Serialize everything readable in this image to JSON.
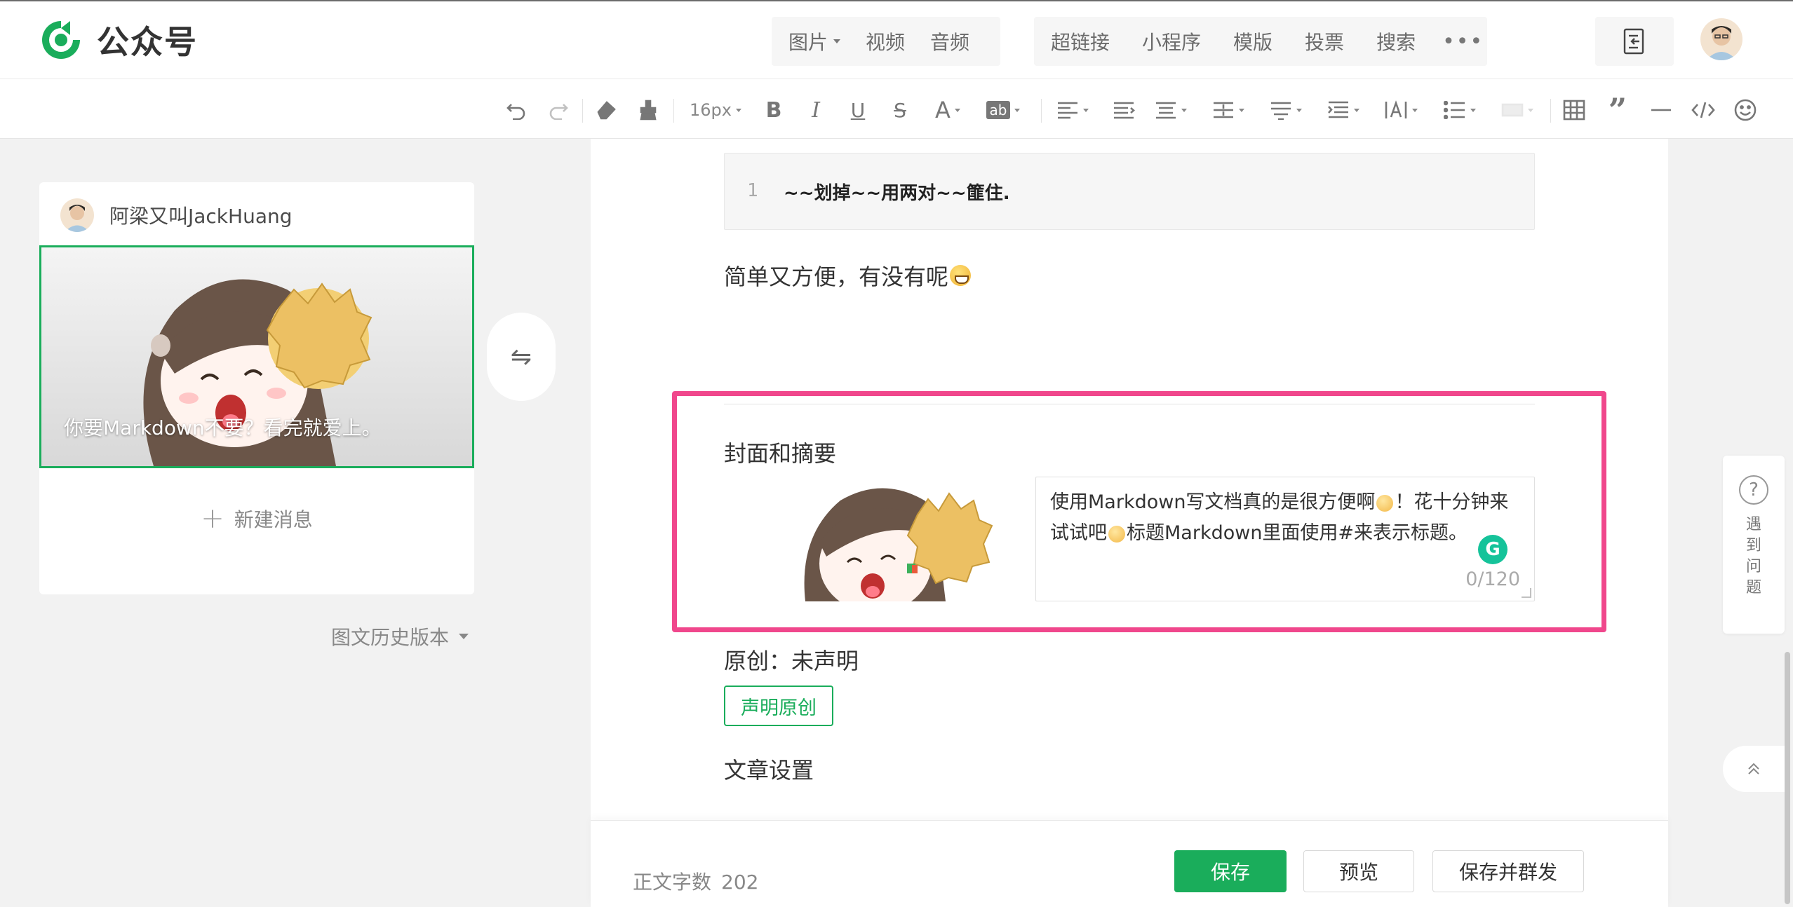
{
  "app": {
    "name": "公众号"
  },
  "nav": {
    "media": [
      {
        "label": "图片",
        "has_dropdown": true
      },
      {
        "label": "视频",
        "has_dropdown": false
      },
      {
        "label": "音频",
        "has_dropdown": false
      }
    ],
    "links": [
      "超链接",
      "小程序",
      "模版",
      "投票",
      "搜索"
    ],
    "more_icon": "ellipsis-icon",
    "doc_icon": "document-toggle-icon"
  },
  "toolbar": {
    "font_size": "16px",
    "tools": [
      "undo-icon",
      "redo-icon",
      "eraser-icon",
      "format-painter-icon",
      "bold-icon",
      "italic-icon",
      "underline-icon",
      "strikethrough-icon",
      "font-color-icon",
      "background-color-icon",
      "align-icon",
      "indent-icon",
      "justify-icon",
      "line-height-icon",
      "paragraph-spacing-icon",
      "list-indent-icon",
      "letter-spacing-icon",
      "bullet-list-icon",
      "border-icon",
      "table-icon",
      "quote-icon",
      "horizontal-rule-icon",
      "code-icon",
      "emoji-icon"
    ]
  },
  "left_panel": {
    "author": "阿梁又叫JackHuang",
    "cover_title": "你要Markdown不要？看完就爱上。",
    "new_message": "新建消息",
    "history": "图文历史版本"
  },
  "editor": {
    "code_line_number": "1",
    "code_text": "~~划掉~~用两对~~篚住.",
    "paragraph": "简单又方便，有没有呢",
    "cover_section_title": "封面和摘要",
    "summary_part1": "使用Markdown写文档真的是很方便啊",
    "summary_part2": "！花十分钟来试试吧",
    "summary_part3": "标题Markdown里面使用#来表示标题。",
    "summary_counter": "0/120",
    "original_label": "原创：未声明",
    "declare_button": "声明原创",
    "article_settings": "文章设置"
  },
  "bottom": {
    "word_count_label": "正文字数",
    "word_count_value": "202",
    "save": "保存",
    "preview": "预览",
    "save_and_send": "保存并群发"
  },
  "help": {
    "label": "遇到问题"
  },
  "colors": {
    "brand_green": "#1aad5b",
    "highlight_pink": "#f0478c"
  }
}
